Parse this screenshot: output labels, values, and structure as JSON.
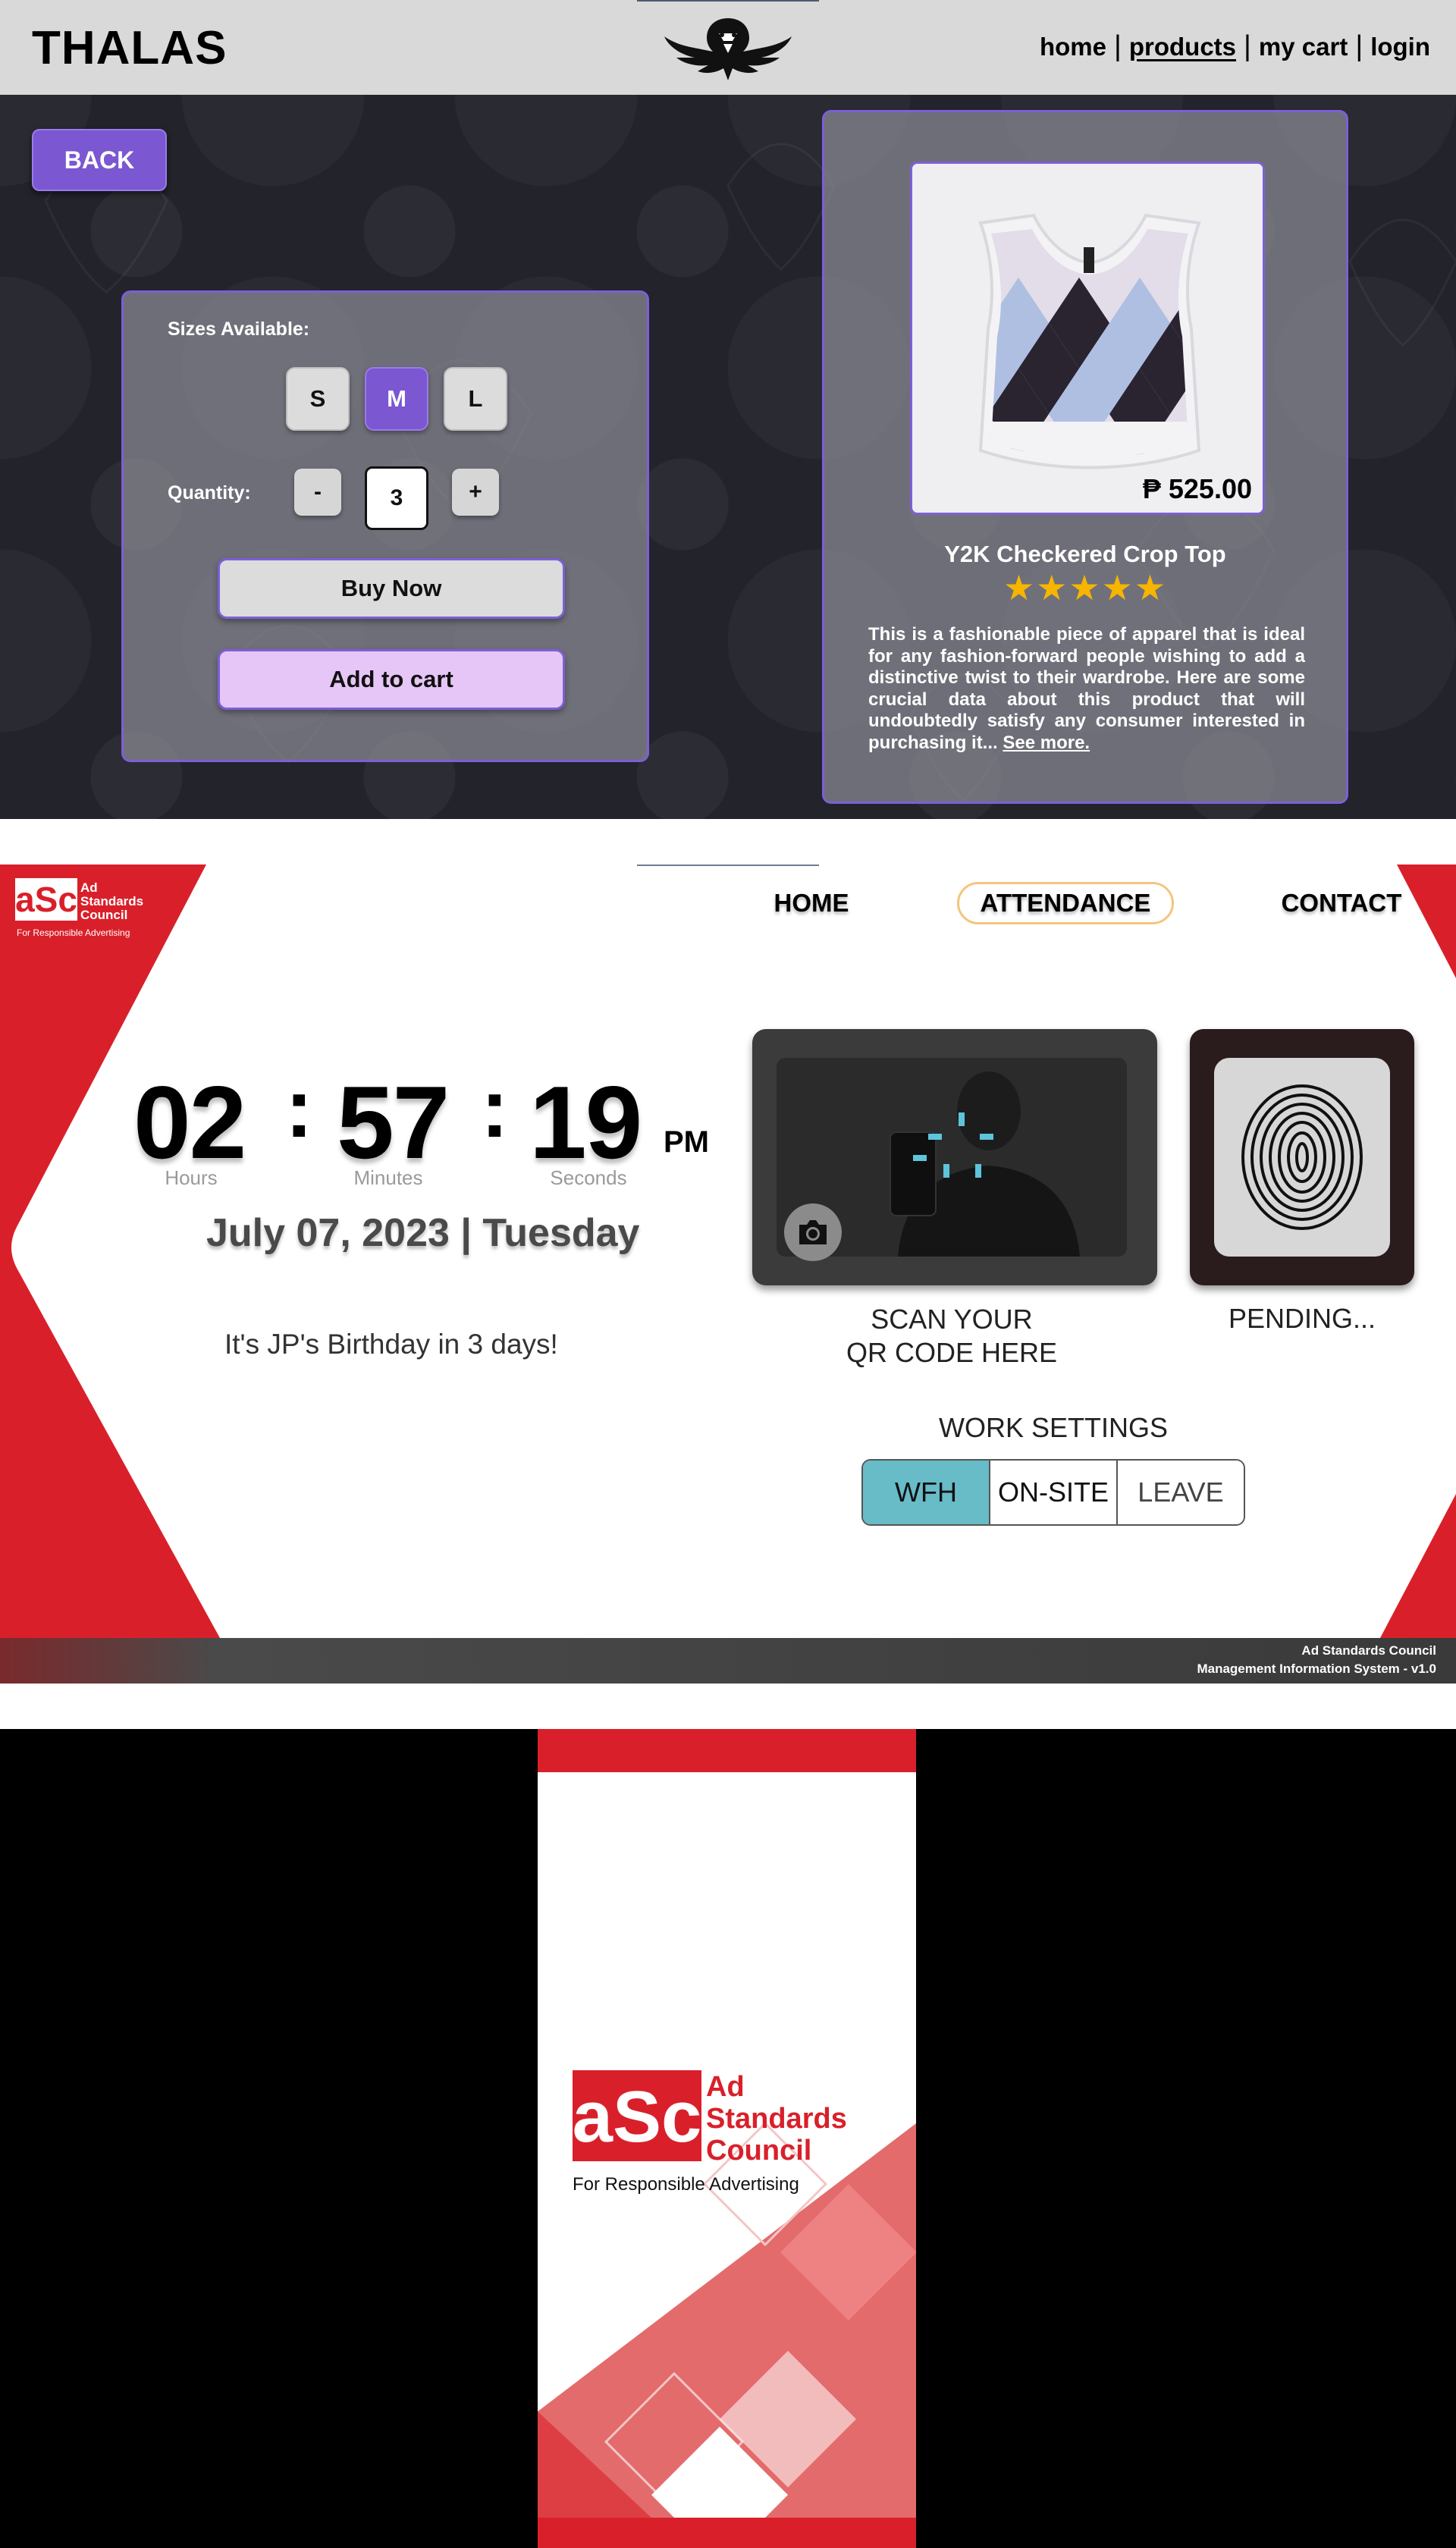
{
  "thalas": {
    "brand": "THALAS",
    "nav": {
      "home": "home",
      "products": "products",
      "cart": "my cart",
      "login": "login",
      "separator": "|"
    },
    "back_label": "BACK",
    "options": {
      "sizes_label": "Sizes Available:",
      "sizes": [
        "S",
        "M",
        "L"
      ],
      "selected_size": "M",
      "quantity_label": "Quantity:",
      "minus": "-",
      "quantity": "3",
      "plus": "+",
      "buy_now": "Buy Now",
      "add_to_cart": "Add to cart"
    },
    "product": {
      "price": "₱ 525.00",
      "title": "Y2K Checkered Crop Top",
      "rating": 5,
      "stars": "★★★★★",
      "description": "This is a fashionable piece of apparel that is ideal for any fashion-forward people wishing to add a distinctive twist to their wardrobe. Here are some crucial data about this product that will undoubtedly satisfy any consumer interested in purchasing it... ",
      "see_more": "See more."
    }
  },
  "attendance": {
    "nav": {
      "home": "HOME",
      "attendance": "ATTENDANCE",
      "contact": "CONTACT"
    },
    "logo_text": [
      "Ad",
      "Standards",
      "Council"
    ],
    "logo_tagline": "For Responsible Advertising",
    "clock": {
      "hours": "02",
      "minutes": "57",
      "seconds": "19",
      "colon": ":",
      "ampm": "PM",
      "hours_label": "Hours",
      "minutes_label": "Minutes",
      "seconds_label": "Seconds"
    },
    "date": "July 07, 2023 | Tuesday",
    "birthday": "It's JP's Birthday in 3 days!",
    "scan_line1": "SCAN YOUR",
    "scan_line2": "QR CODE HERE",
    "fingerprint_status": "PENDING...",
    "work_settings": {
      "title": "WORK SETTINGS",
      "options": [
        "WFH",
        "ON-SITE",
        "LEAVE"
      ],
      "selected": "WFH"
    },
    "footer": {
      "line1": "Ad Standards Council",
      "line2": "Management Information System - v1.0"
    },
    "colors": {
      "brand_red": "#d9202a",
      "accent_teal": "#67bcc8",
      "nav_outline": "#f4c57d"
    }
  },
  "splash": {
    "logo_text": [
      "Ad",
      "Standards",
      "Council"
    ],
    "logo_mark": "aSc",
    "tagline": "For Responsible Advertising"
  }
}
